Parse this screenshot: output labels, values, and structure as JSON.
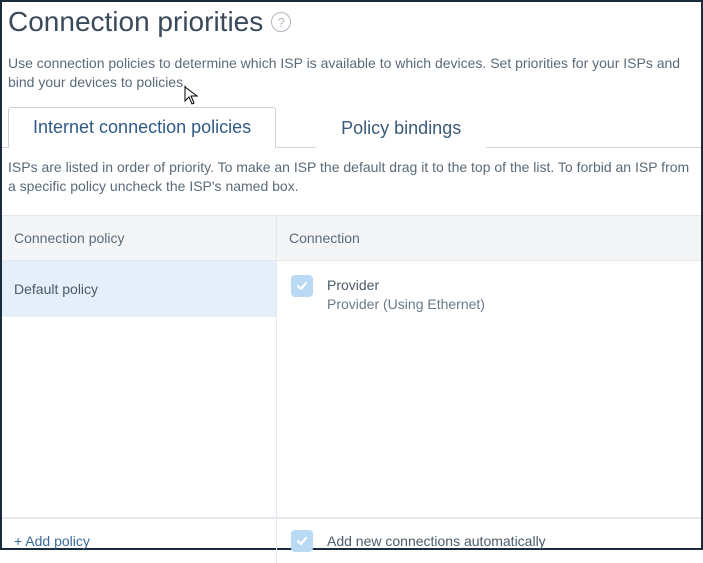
{
  "header": {
    "title": "Connection priorities",
    "help_glyph": "?",
    "intro": "Use connection policies to determine which ISP is available to which devices. Set priorities for your ISPs and bind your devices to policies."
  },
  "tabs": {
    "items": [
      {
        "label": "Internet connection policies",
        "active": true
      },
      {
        "label": "Policy bindings",
        "active": false
      }
    ],
    "description": "ISPs are listed in order of priority. To make an ISP the default drag it to the top of the list. To forbid an ISP from a specific policy uncheck the ISP's named box."
  },
  "columns": {
    "policy_header": "Connection policy",
    "connection_header": "Connection"
  },
  "policies": [
    {
      "name": "Default policy",
      "selected": true
    }
  ],
  "connections": [
    {
      "checked": true,
      "name": "Provider",
      "detail": "Provider (Using Ethernet)"
    }
  ],
  "footer": {
    "add_policy": "+ Add policy",
    "auto_add_checked": true,
    "auto_add_label": "Add new connections automatically"
  }
}
